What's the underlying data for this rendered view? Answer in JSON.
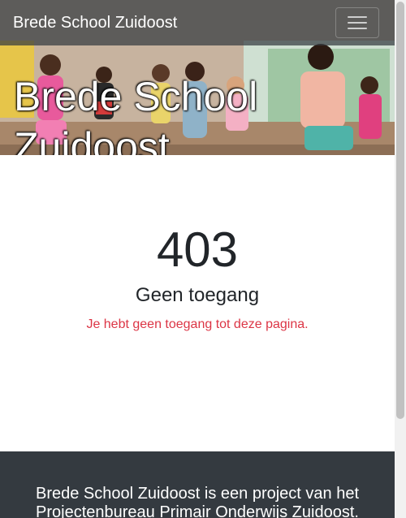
{
  "navbar": {
    "brand": "Brede School Zuidoost",
    "toggle_icon": "hamburger-menu-icon"
  },
  "hero": {
    "title": "Brede School Zuidoost",
    "image": "children-dancing-photo"
  },
  "error": {
    "code": "403",
    "heading": "Geen toegang",
    "message": "Je hebt geen toegang tot deze pagina."
  },
  "footer": {
    "text": "Brede School Zuidoost is een project van het Projectenbureau Primair Onderwijs Zuidoost."
  },
  "colors": {
    "navbar_bg": "#343a40",
    "footer_bg": "#343a40",
    "message": "#dc3545",
    "text": "#212529"
  }
}
